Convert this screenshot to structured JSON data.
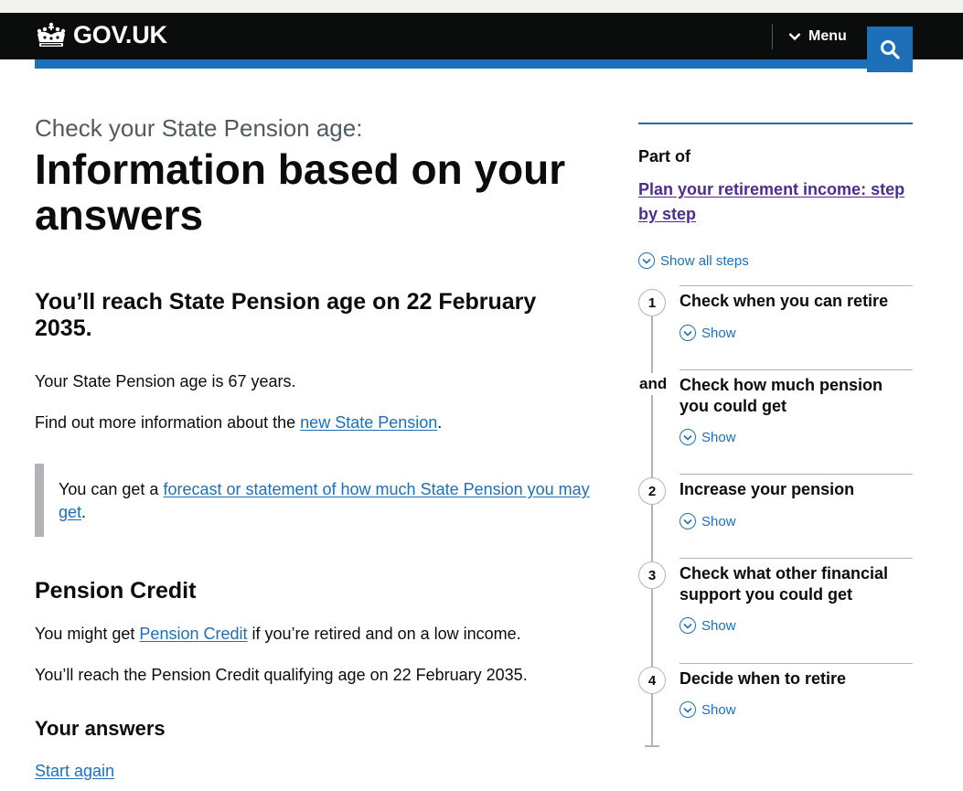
{
  "header": {
    "logo_text": "GOV.UK",
    "menu_label": "Menu",
    "search_icon": "search-icon",
    "brand_color": "#1d70b8"
  },
  "main": {
    "caption": "Check your State Pension age:",
    "title": "Information based on your answers",
    "result_heading": "You’ll reach State Pension age on 22 February 2035.",
    "age_text": "Your State Pension age is 67 years.",
    "more_info_prefix": "Find out more information about the ",
    "more_info_link": "new State Pension",
    "more_info_suffix": ".",
    "inset_prefix": "You can get a ",
    "inset_link": "forecast or statement of how much State Pension you may get",
    "inset_suffix": ".",
    "pension_credit_heading": "Pension Credit",
    "pc_prefix": "You might get ",
    "pc_link": "Pension Credit",
    "pc_suffix": " if you’re retired and on a low income.",
    "pc_age_text": "You’ll reach the Pension Credit qualifying age on 22 February 2035.",
    "your_answers_heading": "Your answers",
    "start_again": "Start again"
  },
  "sidebar": {
    "part_of": "Part of",
    "step_by_step_link": "Plan your retirement income: step by step",
    "show_all": "Show all steps",
    "steps": [
      {
        "number": "1",
        "title": "Check when you can retire",
        "show": "Show"
      },
      {
        "number": "and",
        "title": "Check how much pension you could get",
        "show": "Show"
      },
      {
        "number": "2",
        "title": "Increase your pension",
        "show": "Show"
      },
      {
        "number": "3",
        "title": "Check what other financial support you could get",
        "show": "Show"
      },
      {
        "number": "4",
        "title": "Decide when to retire",
        "show": "Show"
      }
    ]
  }
}
